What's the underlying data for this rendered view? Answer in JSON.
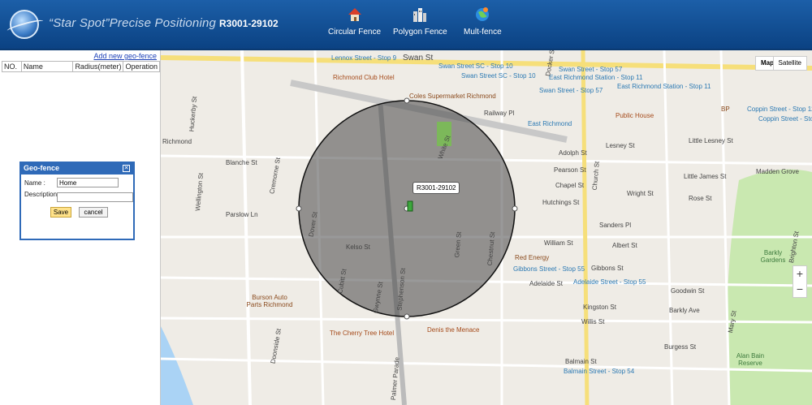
{
  "header": {
    "logo_text": "“Star Spot”Precise Positioning",
    "device_id": "R3001-29102",
    "nav": [
      {
        "label": "Circular Fence",
        "icon": "house-icon"
      },
      {
        "label": "Polygon Fence",
        "icon": "buildings-icon"
      },
      {
        "label": "Mult-fence",
        "icon": "globe-icon"
      }
    ]
  },
  "sidebar": {
    "add_link": "Add new geo-fence",
    "columns": [
      "NO.",
      "Name",
      "Radius(meter)",
      "Operation"
    ]
  },
  "dialog": {
    "title": "Geo-fence",
    "name_label": "Name :",
    "name_value": "Home",
    "desc_label": "Description",
    "desc_value": "",
    "save_label": "Save",
    "cancel_label": "cancel"
  },
  "map": {
    "map_btn": "Map",
    "satellite_btn": "Satellite",
    "zoom_in": "+",
    "zoom_out": "−",
    "device_label": "R3001-29102",
    "labels": [
      {
        "text": "Swan St",
        "cls": "st big"
      },
      {
        "text": "Lennox Street - Stop 9",
        "cls": "stop"
      },
      {
        "text": "Richmond Club Hotel",
        "cls": "place"
      },
      {
        "text": "Coles Supermarket Richmond",
        "cls": "poi"
      },
      {
        "text": "Swan Street SC - Stop 10",
        "cls": "stop"
      },
      {
        "text": "Swan Street SC - Stop 10",
        "cls": "stop"
      },
      {
        "text": "Swan Street - Stop 57",
        "cls": "stop"
      },
      {
        "text": "East Richmond Station - Stop 11",
        "cls": "stop"
      },
      {
        "text": "East Richmond Station - Stop 11",
        "cls": "stop"
      },
      {
        "text": "Swan Street - Stop 57",
        "cls": "stop"
      },
      {
        "text": "Railway Pl",
        "cls": "st"
      },
      {
        "text": "Public House",
        "cls": "place"
      },
      {
        "text": "East Richmond",
        "cls": "stop"
      },
      {
        "text": "BP",
        "cls": "poi"
      },
      {
        "text": "Coppin Street - Stop 12",
        "cls": "stop"
      },
      {
        "text": "Coppin Street - Stop 12",
        "cls": "stop"
      },
      {
        "text": "Little Lesney St",
        "cls": "st"
      },
      {
        "text": "Lesney St",
        "cls": "st"
      },
      {
        "text": "Adolph St",
        "cls": "st"
      },
      {
        "text": "Pearson St",
        "cls": "st"
      },
      {
        "text": "Little James St",
        "cls": "st"
      },
      {
        "text": "Madden Grove",
        "cls": "st"
      },
      {
        "text": "Chapel St",
        "cls": "st"
      },
      {
        "text": "Hutchings St",
        "cls": "st"
      },
      {
        "text": "Wright St",
        "cls": "st"
      },
      {
        "text": "Rose St",
        "cls": "st"
      },
      {
        "text": "Sanders Pl",
        "cls": "st"
      },
      {
        "text": "Albert St",
        "cls": "st"
      },
      {
        "text": "William St",
        "cls": "st"
      },
      {
        "text": "Red Energy",
        "cls": "poi"
      },
      {
        "text": "Gibbons Street - Stop 55",
        "cls": "stop"
      },
      {
        "text": "Gibbons St",
        "cls": "st"
      },
      {
        "text": "Adelaide St",
        "cls": "st"
      },
      {
        "text": "Adelaide Street - Stop 55",
        "cls": "stop"
      },
      {
        "text": "Goodwin St",
        "cls": "st"
      },
      {
        "text": "Kingston St",
        "cls": "st"
      },
      {
        "text": "Barkly Ave",
        "cls": "st"
      },
      {
        "text": "Willis St",
        "cls": "st"
      },
      {
        "text": "Burgess St",
        "cls": "st"
      },
      {
        "text": "Balmain St",
        "cls": "st"
      },
      {
        "text": "Balmain Street - Stop 54",
        "cls": "stop"
      },
      {
        "text": "Barkly Gardens",
        "cls": "park"
      },
      {
        "text": "Alan Bain Reserve",
        "cls": "park"
      },
      {
        "text": "Denis the Menace",
        "cls": "place"
      },
      {
        "text": "The Cherry Tree Hotel",
        "cls": "place"
      },
      {
        "text": "Burson Auto Parts Richmond",
        "cls": "poi"
      },
      {
        "text": "Kelso St",
        "cls": "st"
      },
      {
        "text": "Parslow Ln",
        "cls": "st"
      },
      {
        "text": "Blanche St",
        "cls": "st"
      },
      {
        "text": "Cremorne St",
        "cls": "st"
      },
      {
        "text": "Wellington St",
        "cls": "st"
      },
      {
        "text": "Huckerby St",
        "cls": "st"
      },
      {
        "text": "Richmond",
        "cls": "st"
      },
      {
        "text": "Dover St",
        "cls": "st"
      },
      {
        "text": "Cubitt St",
        "cls": "st"
      },
      {
        "text": "Gwynne St",
        "cls": "st"
      },
      {
        "text": "Stephenson St",
        "cls": "st"
      },
      {
        "text": "Green St",
        "cls": "st"
      },
      {
        "text": "Chestnut St",
        "cls": "st"
      },
      {
        "text": "Church St",
        "cls": "st"
      },
      {
        "text": "Docker St",
        "cls": "st"
      },
      {
        "text": "Mary St",
        "cls": "st"
      },
      {
        "text": "Brighton St",
        "cls": "st"
      },
      {
        "text": "White St",
        "cls": "st"
      },
      {
        "text": "Palmer Parade",
        "cls": "st"
      },
      {
        "text": "Doonside St",
        "cls": "st"
      }
    ]
  }
}
